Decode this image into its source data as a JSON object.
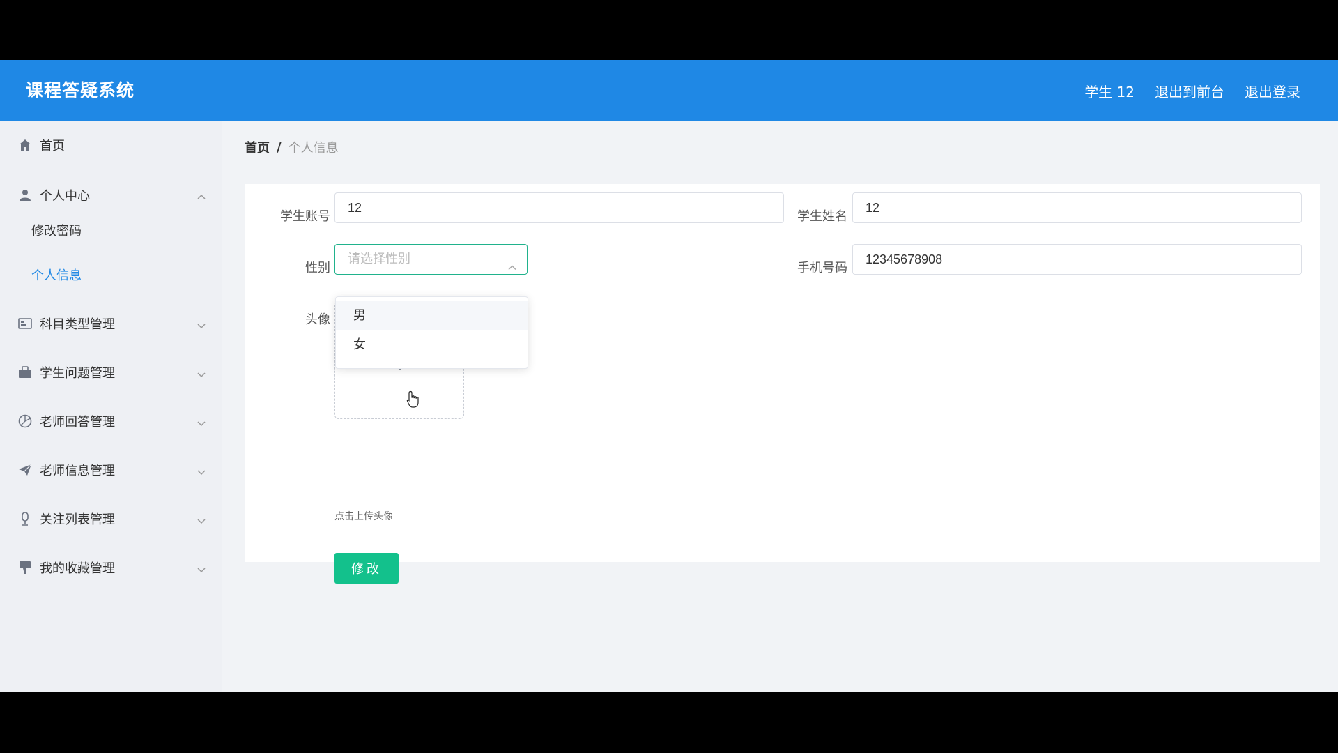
{
  "header": {
    "title": "课程答疑系统",
    "user_label": "学生 12",
    "back_front_label": "退出到前台",
    "logout_label": "退出登录"
  },
  "sidebar": {
    "home": "首页",
    "personal_center": "个人中心",
    "change_password": "修改密码",
    "personal_info": "个人信息",
    "subject_type_mgmt": "科目类型管理",
    "student_question_mgmt": "学生问题管理",
    "teacher_answer_mgmt": "老师回答管理",
    "teacher_info_mgmt": "老师信息管理",
    "follow_list_mgmt": "关注列表管理",
    "favorites_mgmt": "我的收藏管理"
  },
  "breadcrumb": {
    "home": "首页",
    "separator": "/",
    "current": "个人信息"
  },
  "form": {
    "account_label": "学生账号",
    "account_value": "12",
    "name_label": "学生姓名",
    "name_value": "12",
    "gender_label": "性别",
    "gender_placeholder": "请选择性别",
    "phone_label": "手机号码",
    "phone_value": "12345678908",
    "avatar_label": "头像",
    "avatar_hint": "点击上传头像",
    "submit_label": "修改"
  },
  "gender_dropdown": {
    "options": [
      "男",
      "女"
    ]
  },
  "colors": {
    "header_bg": "#1f88e5",
    "active_menu": "#1f88e5",
    "submit_bg": "#13c18c",
    "select_border": "#20b28c"
  }
}
